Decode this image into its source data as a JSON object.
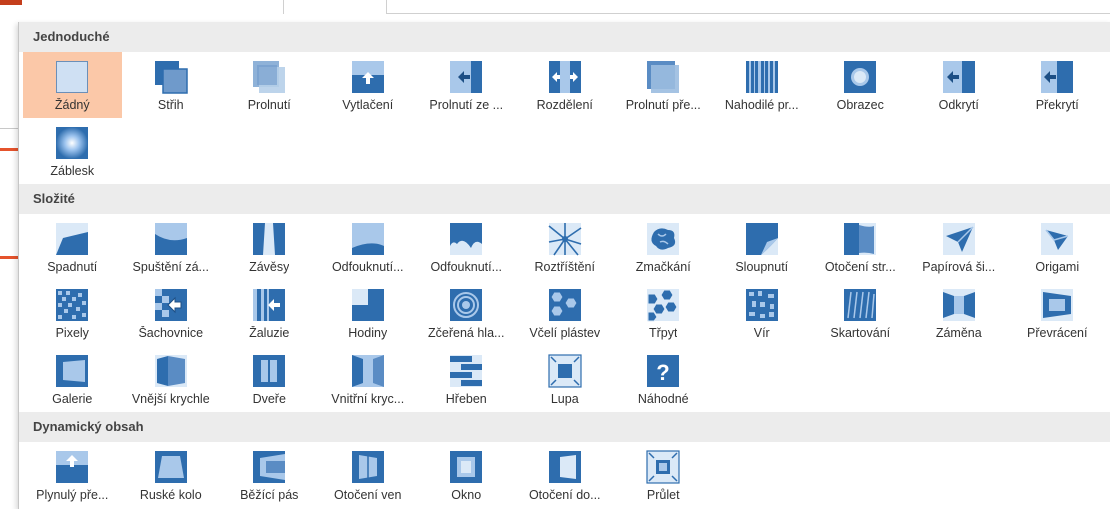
{
  "categories": [
    {
      "name": "Jednoduché",
      "items": [
        {
          "label": "Žádný",
          "icon": "none-icon",
          "selected": true
        },
        {
          "label": "Střih",
          "icon": "cut-icon"
        },
        {
          "label": "Prolnutí",
          "icon": "fade-icon"
        },
        {
          "label": "Vytlačení",
          "icon": "push-icon"
        },
        {
          "label": "Prolnutí ze ...",
          "icon": "wipe-icon"
        },
        {
          "label": "Rozdělení",
          "icon": "split-icon"
        },
        {
          "label": "Prolnutí pře...",
          "icon": "reveal-icon"
        },
        {
          "label": "Nahodilé pr...",
          "icon": "random-bars-icon"
        },
        {
          "label": "Obrazec",
          "icon": "shape-icon"
        },
        {
          "label": "Odkrytí",
          "icon": "uncover-icon"
        },
        {
          "label": "Překrytí",
          "icon": "cover-icon"
        },
        {
          "label": "Záblesk",
          "icon": "flash-icon"
        }
      ]
    },
    {
      "name": "Složité",
      "items": [
        {
          "label": "Spadnutí",
          "icon": "fall-over-icon"
        },
        {
          "label": "Spuštění zá...",
          "icon": "drape-icon"
        },
        {
          "label": "Závěsy",
          "icon": "curtains-icon"
        },
        {
          "label": "Odfouknutí...",
          "icon": "wind-icon"
        },
        {
          "label": "Odfouknutí...",
          "icon": "prestige-icon"
        },
        {
          "label": "Roztříštění",
          "icon": "fracture-icon"
        },
        {
          "label": "Zmačkání",
          "icon": "crush-icon"
        },
        {
          "label": "Sloupnutí",
          "icon": "peel-off-icon"
        },
        {
          "label": "Otočení str...",
          "icon": "page-curl-icon"
        },
        {
          "label": "Papírová ši...",
          "icon": "airplane-icon"
        },
        {
          "label": "Origami",
          "icon": "origami-icon"
        },
        {
          "label": "Pixely",
          "icon": "dissolve-icon"
        },
        {
          "label": "Šachovnice",
          "icon": "checkerboard-icon"
        },
        {
          "label": "Žaluzie",
          "icon": "blinds-icon"
        },
        {
          "label": "Hodiny",
          "icon": "clock-icon"
        },
        {
          "label": "Zčeřená hla...",
          "icon": "ripple-icon"
        },
        {
          "label": "Včelí plástev",
          "icon": "honeycomb-icon"
        },
        {
          "label": "Třpyt",
          "icon": "glitter-icon"
        },
        {
          "label": "Vír",
          "icon": "vortex-icon"
        },
        {
          "label": "Skartování",
          "icon": "shred-icon"
        },
        {
          "label": "Záměna",
          "icon": "switch-icon"
        },
        {
          "label": "Převrácení",
          "icon": "flip-icon"
        },
        {
          "label": "Galerie",
          "icon": "gallery-icon"
        },
        {
          "label": "Vnější krychle",
          "icon": "cube-icon"
        },
        {
          "label": "Dveře",
          "icon": "doors-icon"
        },
        {
          "label": "Vnitřní kryc...",
          "icon": "box-icon"
        },
        {
          "label": "Hřeben",
          "icon": "comb-icon"
        },
        {
          "label": "Lupa",
          "icon": "zoom-icon"
        },
        {
          "label": "Náhodné",
          "icon": "random-icon"
        }
      ]
    },
    {
      "name": "Dynamický obsah",
      "items": [
        {
          "label": "Plynulý pře...",
          "icon": "pan-icon"
        },
        {
          "label": "Ruské kolo",
          "icon": "ferris-wheel-icon"
        },
        {
          "label": "Běžící pás",
          "icon": "conveyor-icon"
        },
        {
          "label": "Otočení ven",
          "icon": "rotate-icon"
        },
        {
          "label": "Okno",
          "icon": "window-icon"
        },
        {
          "label": "Otočení do...",
          "icon": "orbit-icon"
        },
        {
          "label": "Průlet",
          "icon": "fly-through-icon"
        }
      ]
    }
  ],
  "colors": {
    "accent_blue": "#2e6dae",
    "light_blue": "#a9c8ea",
    "selected": "#fbc8a8",
    "header_bg": "#ececec"
  }
}
